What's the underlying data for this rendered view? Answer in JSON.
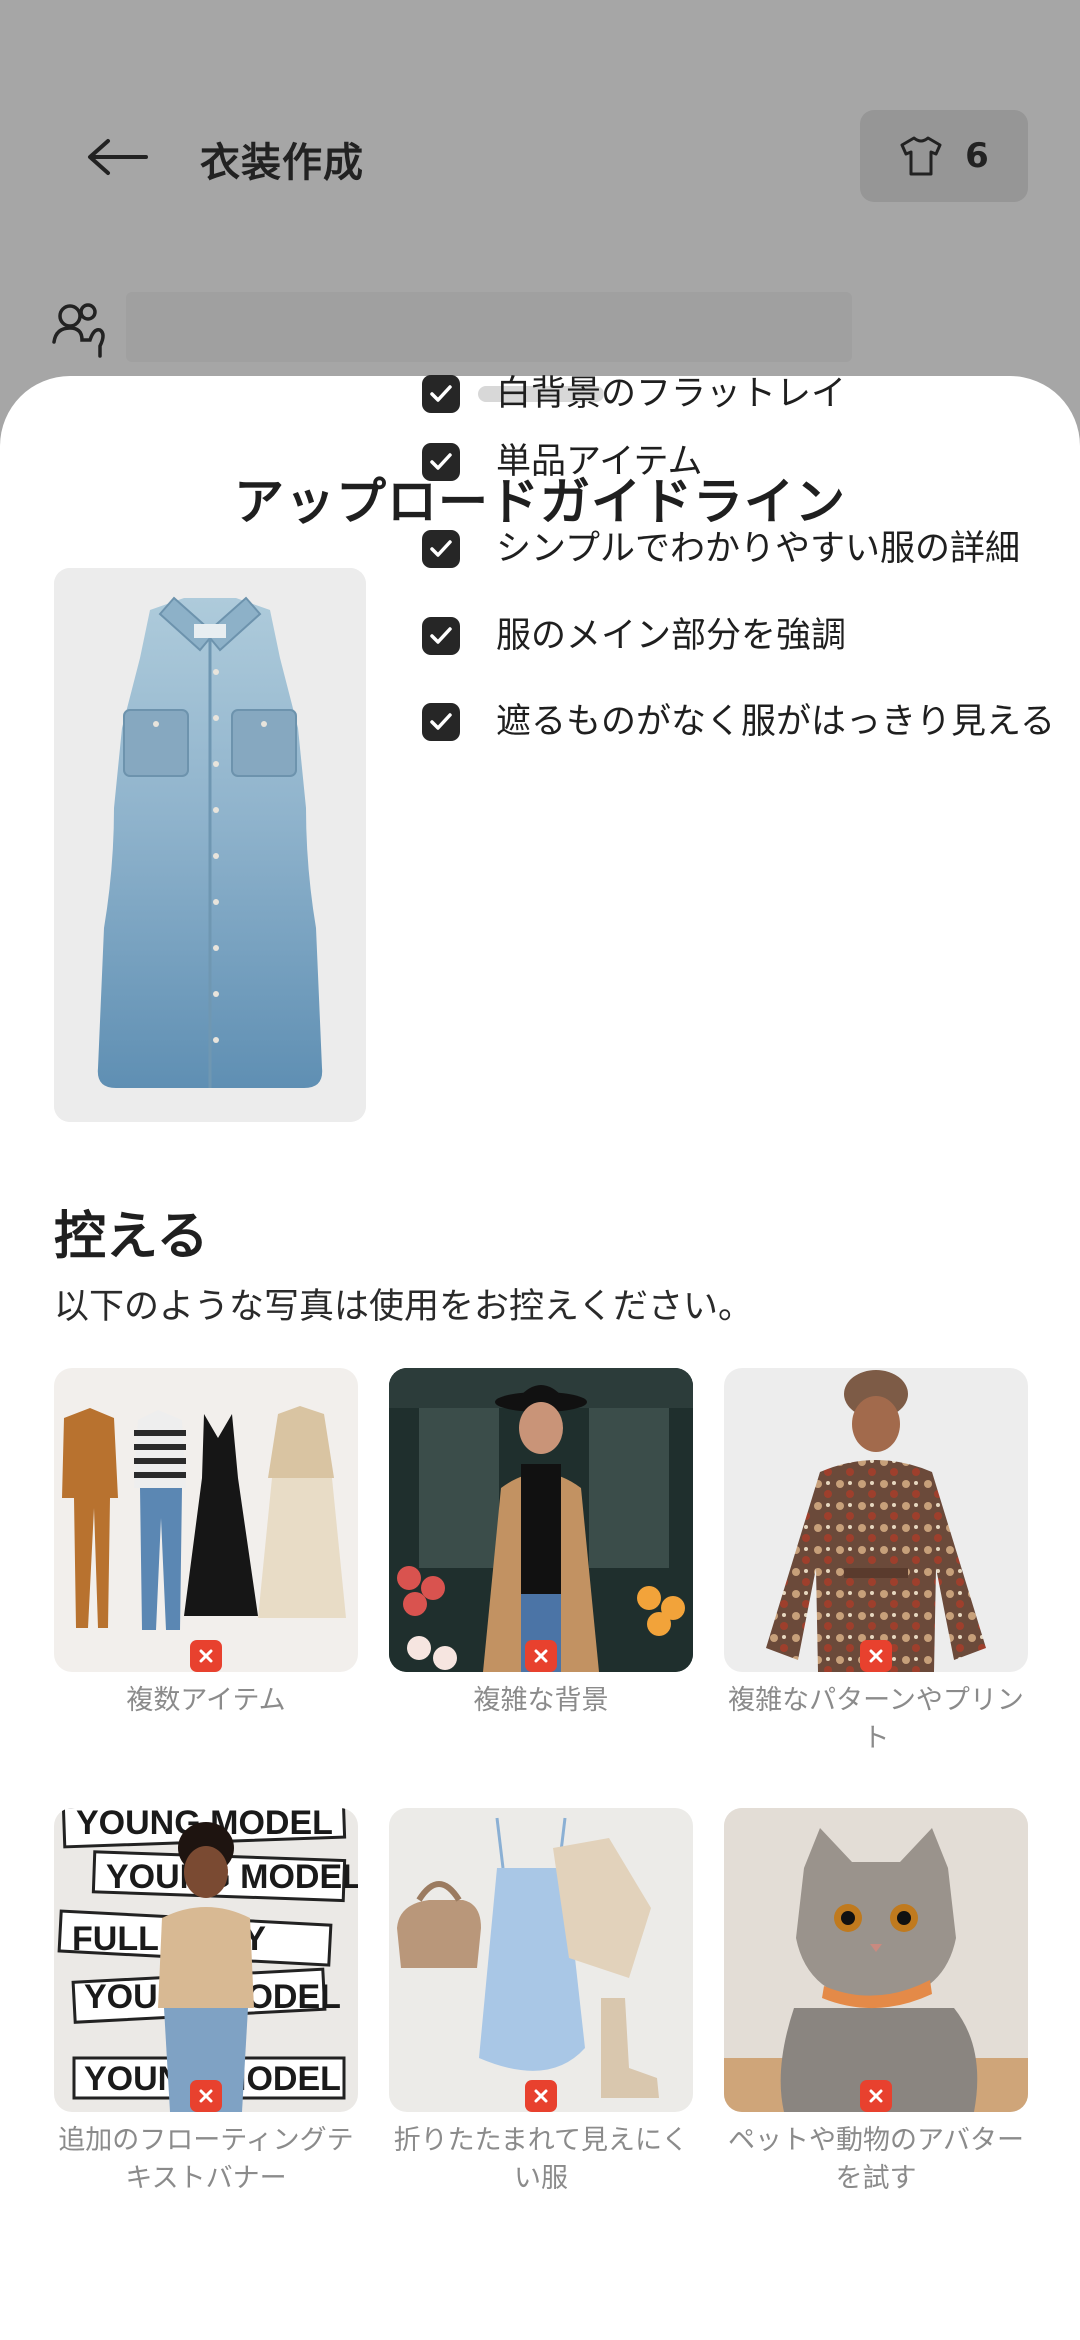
{
  "app": {
    "title": "衣装作成",
    "closet_count": "6",
    "icons": {
      "back": "arrow-left-icon",
      "closet": "tshirt-icon",
      "avatar": "person-icon"
    }
  },
  "sheet": {
    "title": "アップロードガイドライン",
    "guidelines": [
      "白背景のフラットレイ",
      "単品アイテム",
      "シンプルでわかりやすい服の詳細",
      "服のメイン部分を強調",
      "遮るものがなく服がはっきり見える"
    ],
    "avoid_title": "控える",
    "avoid_subtitle": "以下のような写真は使用をお控えください。",
    "bad_examples": [
      "複数アイテム",
      "複雑な背景",
      "複雑なパターンやプリント",
      "追加のフローティングテキストバナー",
      "折りたたまれて見えにくい服",
      "ペットや動物のアバターを試す"
    ],
    "banner_words": [
      "YOUNG MODEL",
      "YOUNG MODEL",
      "FULL BODY",
      "YOUNG MODEL",
      "YOUNG MODEL"
    ]
  },
  "colors": {
    "accent_red": "#e8412e",
    "check_bg": "#262626",
    "overlay": "#a6a6a6"
  }
}
